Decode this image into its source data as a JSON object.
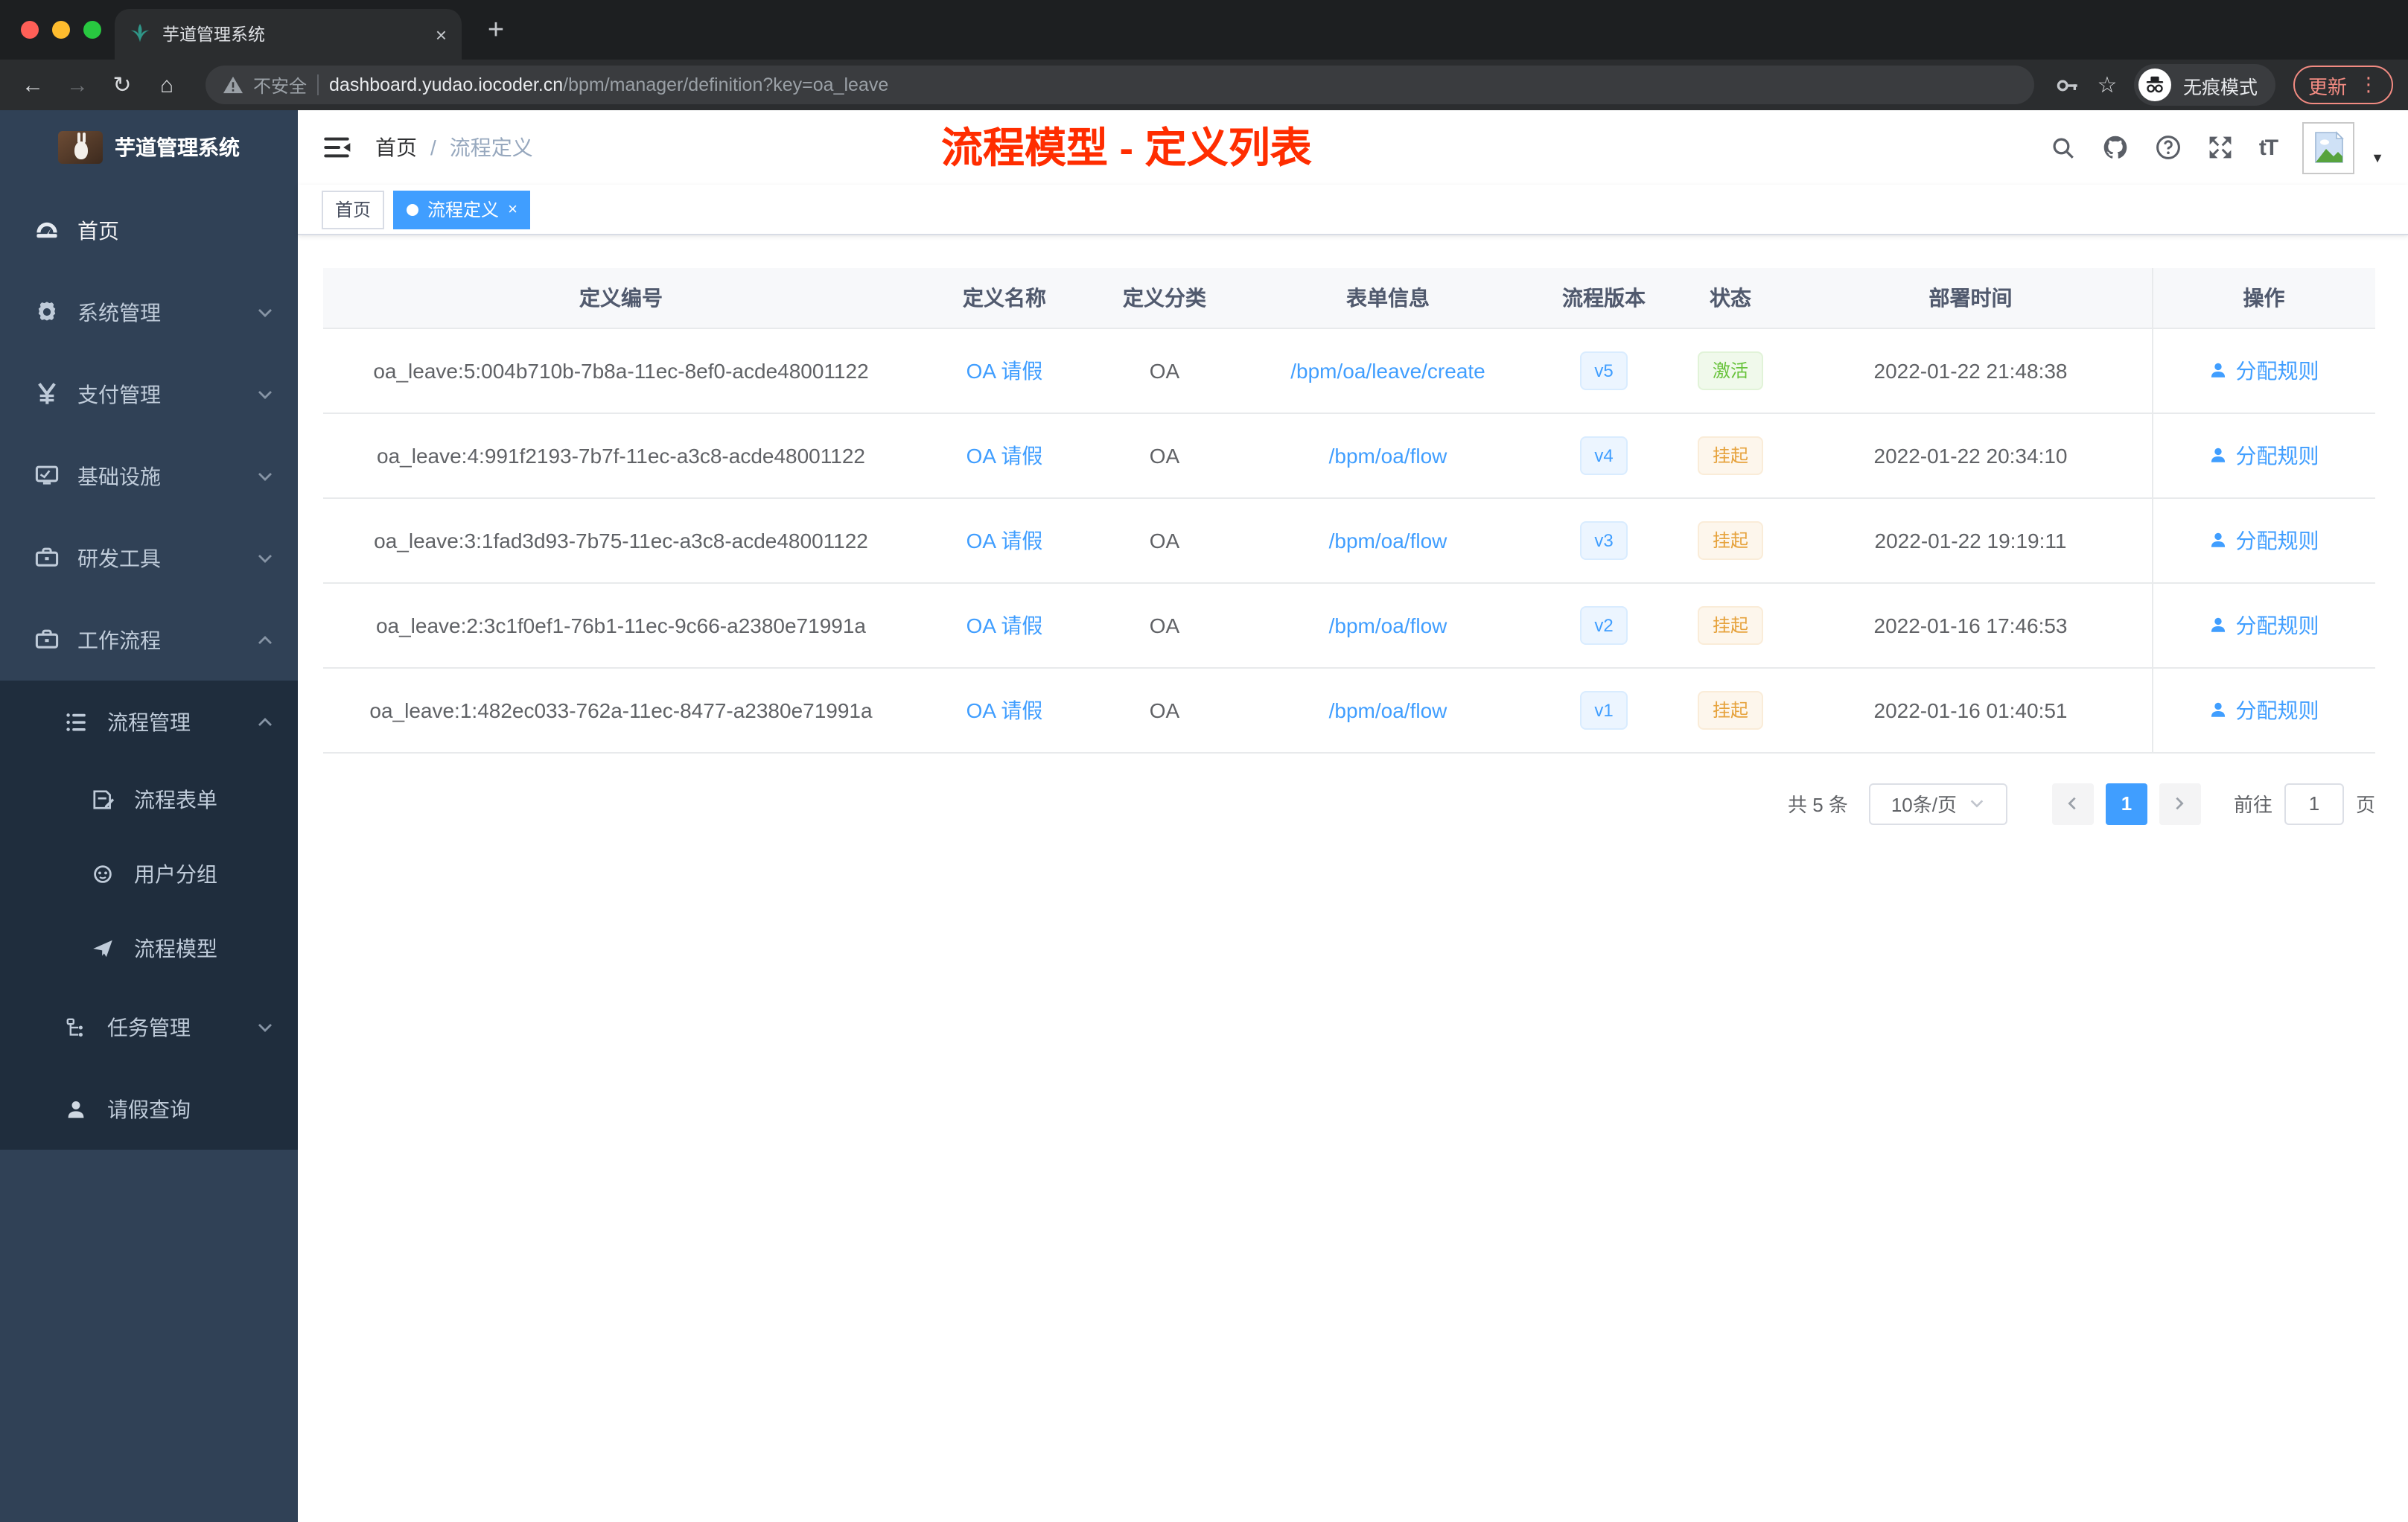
{
  "browser": {
    "tab_title": "芋道管理系统",
    "not_secure": "不安全",
    "url_host": "dashboard.yudao.iocoder.cn",
    "url_path": "/bpm/manager/definition?key=oa_leave",
    "incognito": "无痕模式",
    "update": "更新"
  },
  "icons": {
    "back": "←",
    "forward": "→",
    "reload": "↻",
    "home": "⌂",
    "star": "☆",
    "kebab": "⋮",
    "tab_close": "×",
    "new_tab": "+",
    "question": "?",
    "font_size": "tT",
    "caret": "▼",
    "tag_close": "×"
  },
  "sidebar": {
    "app_title": "芋道管理系统",
    "items": [
      {
        "label": "首页"
      },
      {
        "label": "系统管理"
      },
      {
        "label": "支付管理"
      },
      {
        "label": "基础设施"
      },
      {
        "label": "研发工具"
      },
      {
        "label": "工作流程"
      },
      {
        "label": "流程管理"
      },
      {
        "label": "流程表单"
      },
      {
        "label": "用户分组"
      },
      {
        "label": "流程模型"
      },
      {
        "label": "任务管理"
      },
      {
        "label": "请假查询"
      }
    ]
  },
  "header": {
    "breadcrumb_home": "首页",
    "breadcrumb_sep": "/",
    "breadcrumb_current": "流程定义",
    "annotation": "流程模型 - 定义列表"
  },
  "tags": {
    "home": "首页",
    "active": "流程定义"
  },
  "table": {
    "columns": [
      "定义编号",
      "定义名称",
      "定义分类",
      "表单信息",
      "流程版本",
      "状态",
      "部署时间",
      "操作"
    ],
    "rows": [
      {
        "id": "oa_leave:5:004b710b-7b8a-11ec-8ef0-acde48001122",
        "name": "OA 请假",
        "category": "OA",
        "form": "/bpm/oa/leave/create",
        "version": "v5",
        "status": "激活",
        "time": "2022-01-22 21:48:38",
        "action": "分配规则"
      },
      {
        "id": "oa_leave:4:991f2193-7b7f-11ec-a3c8-acde48001122",
        "name": "OA 请假",
        "category": "OA",
        "form": "/bpm/oa/flow",
        "version": "v4",
        "status": "挂起",
        "time": "2022-01-22 20:34:10",
        "action": "分配规则"
      },
      {
        "id": "oa_leave:3:1fad3d93-7b75-11ec-a3c8-acde48001122",
        "name": "OA 请假",
        "category": "OA",
        "form": "/bpm/oa/flow",
        "version": "v3",
        "status": "挂起",
        "time": "2022-01-22 19:19:11",
        "action": "分配规则"
      },
      {
        "id": "oa_leave:2:3c1f0ef1-76b1-11ec-9c66-a2380e71991a",
        "name": "OA 请假",
        "category": "OA",
        "form": "/bpm/oa/flow",
        "version": "v2",
        "status": "挂起",
        "time": "2022-01-16 17:46:53",
        "action": "分配规则"
      },
      {
        "id": "oa_leave:1:482ec033-762a-11ec-8477-a2380e71991a",
        "name": "OA 请假",
        "category": "OA",
        "form": "/bpm/oa/flow",
        "version": "v1",
        "status": "挂起",
        "time": "2022-01-16 01:40:51",
        "action": "分配规则"
      }
    ]
  },
  "pagination": {
    "total": "共 5 条",
    "page_size": "10条/页",
    "page": "1",
    "goto": "前往",
    "goto_value": "1",
    "unit": "页"
  },
  "colors": {
    "primary": "#409eff",
    "success": "#67c23a",
    "warning": "#e6a23c",
    "annotation_red": "#ff2d00",
    "sidebar_bg": "#304156",
    "sidebar_sub_bg": "#1f2d3d",
    "chrome_dark": "#2b2d2f",
    "update_red": "#f28b82"
  }
}
